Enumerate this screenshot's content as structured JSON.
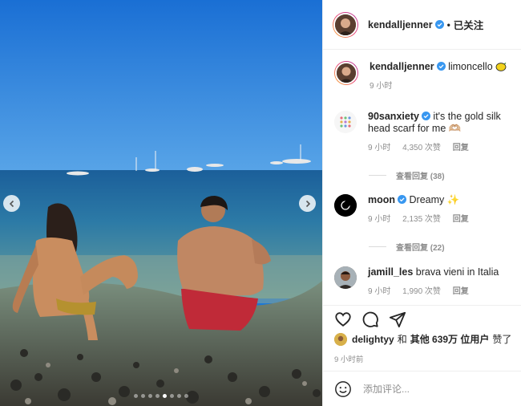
{
  "post": {
    "author": "kendalljenner",
    "follow_status": "已关注",
    "separator": "•"
  },
  "caption": {
    "username": "kendalljenner",
    "text": "limoncello",
    "emoji": "lemon",
    "time": "9 小时"
  },
  "comments": [
    {
      "username": "90sanxiety",
      "verified": true,
      "text": "it's the gold silk head scarf for me 🫶🏼",
      "time": "9 小时",
      "likes": "4,350 次赞",
      "reply": "回复",
      "view_replies": "查看回复 (38)"
    },
    {
      "username": "moon",
      "verified": true,
      "text": "Dreamy ✨",
      "time": "9 小时",
      "likes": "2,135 次赞",
      "reply": "回复",
      "view_replies": "查看回复 (22)"
    },
    {
      "username": "jamill_les",
      "verified": false,
      "text": "brava vieni in Italia",
      "time": "9 小时",
      "likes": "1,990 次赞",
      "reply": "回复"
    }
  ],
  "likes_line": {
    "user": "delightyy",
    "connector": "和",
    "others": "其他 639万 位用户",
    "suffix": "赞了"
  },
  "post_time": "9 小时前",
  "add_comment": {
    "placeholder": "添加评论..."
  },
  "carousel": {
    "total": 8,
    "active": 5
  },
  "colors": {
    "verified": "#3897f0",
    "muted": "#8e8e8e",
    "text": "#262626"
  }
}
